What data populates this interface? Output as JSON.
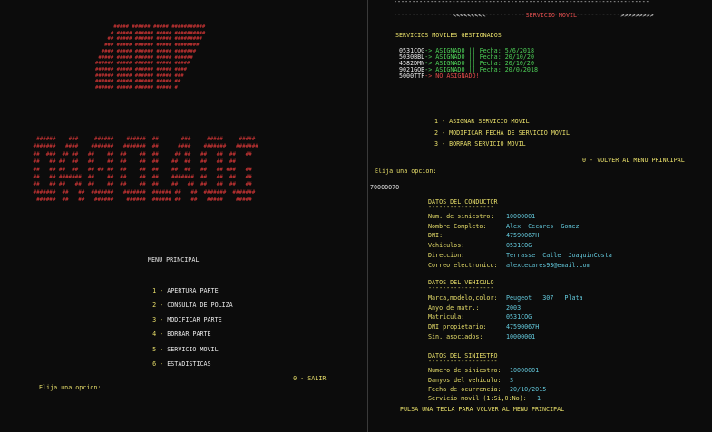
{
  "left_console": {
    "logo_top": "      ##### ###### ##### ###########\n     # ##### ###### ##### ##########\n    ## ##### ###### ##### #########\n   ### ##### ###### ##### ########\n  #### ##### ###### ##### #######\n ##### ##### ###### ##### ######\n###### ##### ###### ##### #####\n###### ##### ###### ##### ####\n###### ##### ###### ##### ###\n###### ##### ###### ##### ##\n###### ##### ###### ##### #",
    "logo_big": "  ######    ###     ######    ######  ##       ###     #####     #####\n #######   ####    #######   #######  ##      ####    #######   #######\n ##  ###  ## ##   ##    ##  ##    ##  ##     ## ##   ##   ##  ##   ##\n ##   ## ##  ##   ##    ##  ##    ##  ##    ##  ##   ##   ##  ##\n ##   ## ##  ##   ## ## ##  ##    ##  ##    ##  ##   ##   ## ###   ##\n ##   ## #######  ##    ##  ##    ##  ##    #######  ##   ##  ##   ##\n ##   ## ##   ##  ##    ##  ##    ##  ##    ##   ##  ##   ##  ##   ##\n #######  ##   ##  #######   #######  ###### ##   ##  #######  #######\n  ######  ##   ##   ######    ######  ###### ##   ##   #####    #####",
    "title": "MENU PRINCIPAL",
    "menu": [
      {
        "num": "1 -",
        "label": "APERTURA PARTE"
      },
      {
        "num": "2 -",
        "label": "CONSULTA DE POLIZA"
      },
      {
        "num": "3 -",
        "label": "MODIFICAR PARTE"
      },
      {
        "num": "4 -",
        "label": "BORRAR PARTE"
      },
      {
        "num": "5 -",
        "label": "SERVICIO MOVIL"
      },
      {
        "num": "6 -",
        "label": "ESTADISTICAS"
      }
    ],
    "exit": {
      "num": "0 -",
      "label": "SALIR"
    },
    "prompt": "Elija una opcion:"
  },
  "right_console": {
    "rule": "----------------------------------------------------------------------",
    "header_left": "<<<<<<<<<",
    "header_title": "SERVICIO MOVIL",
    "header_right": ">>>>>>>>>",
    "managed_title": "SERVICIOS MOVILES GESTIONADOS",
    "services": [
      {
        "plate": "0531COG",
        "status": "-> ASIGNADO || Fecha: 5/6/2018",
        "assigned": true
      },
      {
        "plate": "5030BBL",
        "status": "-> ASIGNADO || Fecha: 20/10/20",
        "assigned": true
      },
      {
        "plate": "4582DMN",
        "status": "-> ASIGNADO || Fecha: 20/10/20",
        "assigned": true
      },
      {
        "plate": "9021GOB",
        "status": "-> ASIGNADO || Fecha: 20/0/2018",
        "assigned": true
      },
      {
        "plate": "5000TTF",
        "status": "-> NO ASIGNADO!",
        "assigned": false
      }
    ],
    "options": [
      "1 - ASIGNAR SERVICIO MOVIL",
      "2 - MODIFICAR FECHA DE SERVICIO MOVIL",
      "3 - BORRAR SERVICIO MOVIL"
    ],
    "back": "0 - VOLVER AL MENU PRINCIPAL",
    "prompt": "Elija una opcion:",
    "input_value": "70000070",
    "driver_section": {
      "title": "DATOS DEL CONDUCTOR",
      "underline": "------------------",
      "rows": [
        {
          "label": "Num. de siniestro:",
          "value": "10000001"
        },
        {
          "label": "Nombre Completo:",
          "value": "Alex  Cecares  Gomez"
        },
        {
          "label": "DNI:",
          "value": "47590067H"
        },
        {
          "label": "Vehiculos:",
          "value": "0531COG"
        },
        {
          "label": "Direccion:",
          "value": "Terrasse  Calle  JoaquinCosta"
        },
        {
          "label": "Correo electronico:",
          "value": "alexcecares93@email.com"
        }
      ]
    },
    "vehicle_section": {
      "title": "DATOS DEL VEHICULO",
      "underline": "------------------",
      "rows": [
        {
          "label": "Marca,modelo,color:",
          "value": "Peugeot   307   Plata"
        },
        {
          "label": "Anyo de matr.:",
          "value": "2003"
        },
        {
          "label": "Matricula:",
          "value": "0531COG"
        },
        {
          "label": "DNI propietario:",
          "value": "47590067H"
        },
        {
          "label": "Sin. asociados:",
          "value": "10000001"
        }
      ]
    },
    "claim_section": {
      "title": "DATOS DEL SINIESTRO",
      "underline": "-------------------",
      "rows": [
        {
          "label": "Numero de siniestro:",
          "value": "10000001"
        },
        {
          "label": "Danyos del vehiculo:",
          "value": "S"
        },
        {
          "label": "Fecha de ocurrencia:",
          "value": "20/10/2015"
        },
        {
          "label": "Servicio movil (1:Si,0:No):",
          "value": "1"
        }
      ]
    },
    "footer": "PULSA UNA TECLA PARA VOLVER AL MENU PRINCIPAL"
  }
}
